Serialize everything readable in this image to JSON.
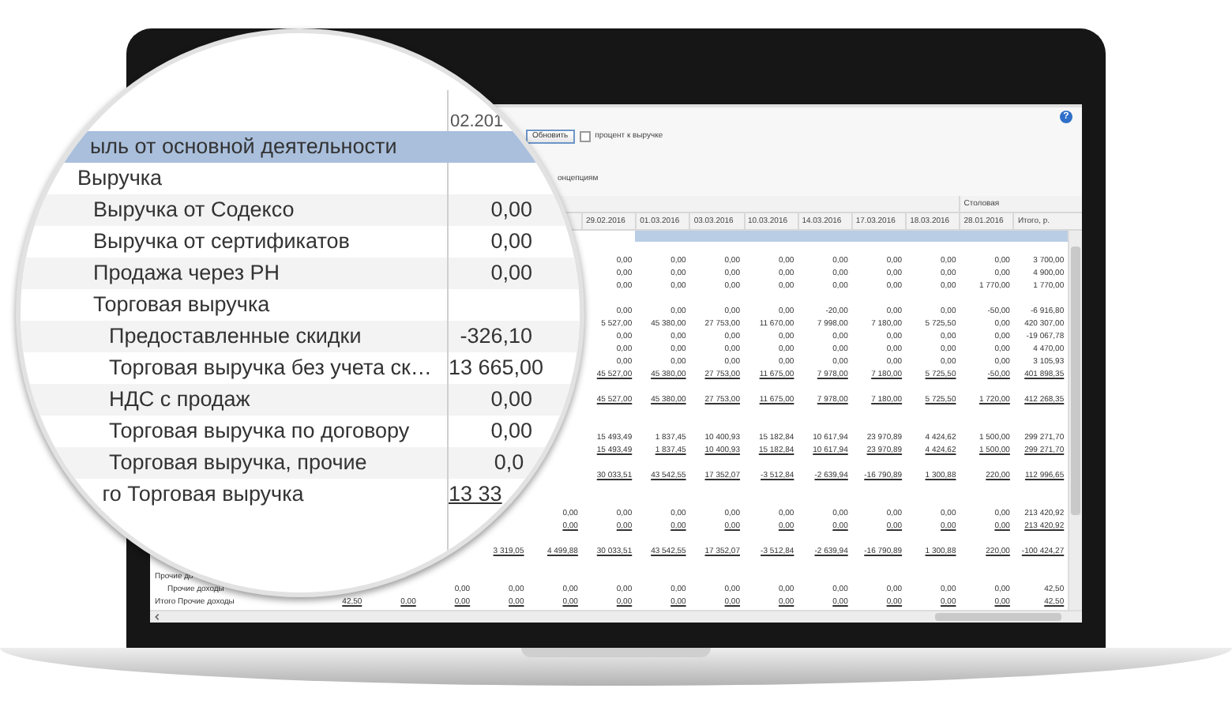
{
  "toolbar": {
    "help_icon": "?",
    "refresh_button": "Обновить",
    "percent_checkbox": {
      "label": "процент к выручке",
      "checked": false
    },
    "grouping_label": "онцепциям"
  },
  "table": {
    "columns": [
      {
        "label": "29.02.2016"
      },
      {
        "label": "01.03.2016"
      },
      {
        "label": "03.03.2016"
      },
      {
        "label": "10.03.2016"
      },
      {
        "label": "14.03.2016"
      },
      {
        "label": "17.03.2016"
      },
      {
        "label": "18.03.2016"
      },
      {
        "label": "28.01.2016",
        "group": "Столовая"
      },
      {
        "label": "Итого, р."
      }
    ],
    "rows": [
      {
        "kind": "heading"
      },
      {
        "kind": "blank"
      },
      {
        "kind": "values",
        "cells": [
          "0,00",
          "0,00",
          "0,00",
          "0,00",
          "0,00",
          "0,00",
          "0,00",
          "0,00",
          "3 700,00"
        ]
      },
      {
        "kind": "values",
        "cells": [
          "0,00",
          "0,00",
          "0,00",
          "0,00",
          "0,00",
          "0,00",
          "0,00",
          "0,00",
          "4 900,00"
        ]
      },
      {
        "kind": "values",
        "cells": [
          "0,00",
          "0,00",
          "0,00",
          "0,00",
          "0,00",
          "0,00",
          "0,00",
          "1 770,00",
          "1 770,00"
        ]
      },
      {
        "kind": "blank"
      },
      {
        "kind": "values",
        "cells": [
          "0,00",
          "0,00",
          "0,00",
          "0,00",
          "-20,00",
          "0,00",
          "0,00",
          "-50,00",
          "-6 916,80"
        ]
      },
      {
        "kind": "values",
        "cells": [
          "5 527,00",
          "45 380,00",
          "27 753,00",
          "11 670,00",
          "7 998,00",
          "7 180,00",
          "5 725,50",
          "0,00",
          "420 307,00"
        ]
      },
      {
        "kind": "values",
        "cells": [
          "0,00",
          "0,00",
          "0,00",
          "0,00",
          "0,00",
          "0,00",
          "0,00",
          "0,00",
          "-19 067,78"
        ]
      },
      {
        "kind": "values",
        "cells": [
          "0,00",
          "0,00",
          "0,00",
          "0,00",
          "0,00",
          "0,00",
          "0,00",
          "0,00",
          "4 470,00"
        ]
      },
      {
        "kind": "values",
        "cells": [
          "0,00",
          "0,00",
          "0,00",
          "0,00",
          "0,00",
          "0,00",
          "0,00",
          "0,00",
          "3 105,93"
        ]
      },
      {
        "kind": "total",
        "cells": [
          "45 527,00",
          "45 380,00",
          "27 753,00",
          "11 675,00",
          "7 978,00",
          "7 180,00",
          "5 725,50",
          "-50,00",
          "401 898,35"
        ]
      },
      {
        "kind": "blank"
      },
      {
        "kind": "total",
        "cells": [
          "45 527,00",
          "45 380,00",
          "27 753,00",
          "11 675,00",
          "7 978,00",
          "7 180,00",
          "5 725,50",
          "1 720,00",
          "412 268,35"
        ]
      },
      {
        "kind": "blank"
      },
      {
        "kind": "blank"
      },
      {
        "kind": "values",
        "cells": [
          "15 493,49",
          "1 837,45",
          "10 400,93",
          "15 182,84",
          "10 617,94",
          "23 970,89",
          "4 424,62",
          "1 500,00",
          "299 271,70"
        ]
      },
      {
        "kind": "total",
        "cells": [
          "15 493,49",
          "1 837,45",
          "10 400,93",
          "15 182,84",
          "10 617,94",
          "23 970,89",
          "4 424,62",
          "1 500,00",
          "299 271,70"
        ]
      },
      {
        "kind": "blank"
      },
      {
        "kind": "total",
        "cells": [
          "30 033,51",
          "43 542,55",
          "17 352,07",
          "-3 512,84",
          "-2 639,94",
          "-16 790,89",
          "1 300,88",
          "220,00",
          "112 996,65"
        ]
      },
      {
        "kind": "blank"
      },
      {
        "kind": "blank"
      },
      {
        "kind": "values",
        "cells": [
          "0,00",
          "0,00",
          "0,00",
          "0,00",
          "0,00",
          "0,00",
          "0,00",
          "0,00",
          "0,00",
          "213 420,92"
        ]
      },
      {
        "kind": "total",
        "cells": [
          "0,00",
          "0,00",
          "0,00",
          "0,00",
          "0,00",
          "0,00",
          "0,00",
          "0,00",
          "0,00",
          "213 420,92"
        ]
      },
      {
        "kind": "blank"
      },
      {
        "kind": "total",
        "cells": [
          "3 319,05",
          "4 499,88",
          "30 033,51",
          "43 542,55",
          "17 352,07",
          "-3 512,84",
          "-2 639,94",
          "-16 790,89",
          "1 300,88",
          "220,00",
          "-100 424,27"
        ]
      },
      {
        "kind": "blank"
      },
      {
        "kind": "values",
        "label": "Прочие до",
        "children": [
          {
            "kind": "values",
            "label": "Прочие доходы",
            "cells": [
              "0,00",
              "0,00",
              "0,00",
              "0,00",
              "0,00",
              "0,00",
              "0,00",
              "0,00",
              "0,00",
              "0,00",
              "0,00",
              "42,50"
            ]
          }
        ]
      },
      {
        "kind": "total",
        "label": "Итого Прочие доходы",
        "cells": [
          "42,50",
          "0,00",
          "0,00",
          "0,00",
          "0,00",
          "0,00",
          "0,00",
          "0,00",
          "0,00",
          "0,00",
          "0,00",
          "0,00",
          "0,00",
          "42,50"
        ]
      }
    ]
  },
  "magnifier": {
    "column_header": "02.201",
    "heading": {
      "label": "ыль от основной деятельности",
      "selected": true
    },
    "rows": [
      {
        "label": "Выручка",
        "kind": "group",
        "children": [
          {
            "label": "Выручка от Содексо",
            "value": "0,00",
            "kind": "item"
          },
          {
            "label": "Выручка от сертификатов",
            "value": "0,00",
            "kind": "item"
          },
          {
            "label": "Продажа через РН",
            "value": "0,00",
            "kind": "item"
          },
          {
            "label": "Торговая выручка",
            "kind": "group",
            "children": [
              {
                "label": "Предоставленные скидки",
                "value": "-326,10",
                "kind": "item"
              },
              {
                "label": "Торговая выручка без учета ск…",
                "value": "13 665,00",
                "kind": "item"
              },
              {
                "label": "НДС с продаж",
                "value": "0,00",
                "kind": "item"
              },
              {
                "label": "Торговая выручка по договору",
                "value": "0,00",
                "kind": "item"
              },
              {
                "label": "Торговая выручка, прочие",
                "value": "0,0",
                "kind": "item"
              }
            ]
          },
          {
            "label": "го Торговая выручка",
            "value": "13 33",
            "kind": "total"
          }
        ]
      }
    ]
  }
}
